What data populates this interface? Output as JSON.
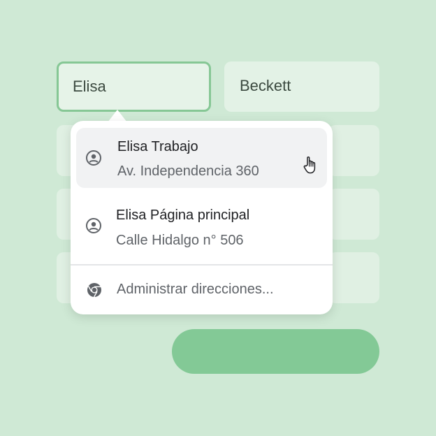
{
  "form": {
    "first_name_value": "Elisa",
    "last_name_value": "Beckett"
  },
  "autofill": {
    "options": [
      {
        "title": "Elisa Trabajo",
        "subtitle": "Av. Independencia 360",
        "icon": "account-circle-icon"
      },
      {
        "title": "Elisa Página principal",
        "subtitle": "Calle Hidalgo n° 506",
        "icon": "account-circle-icon"
      }
    ],
    "manage_label": "Administrar direcciones...",
    "manage_icon": "chrome-icon"
  },
  "colors": {
    "background": "#cfe9d5",
    "field_focus_border": "#86c795",
    "button": "#83c996",
    "hover_row": "#f1f2f3"
  }
}
